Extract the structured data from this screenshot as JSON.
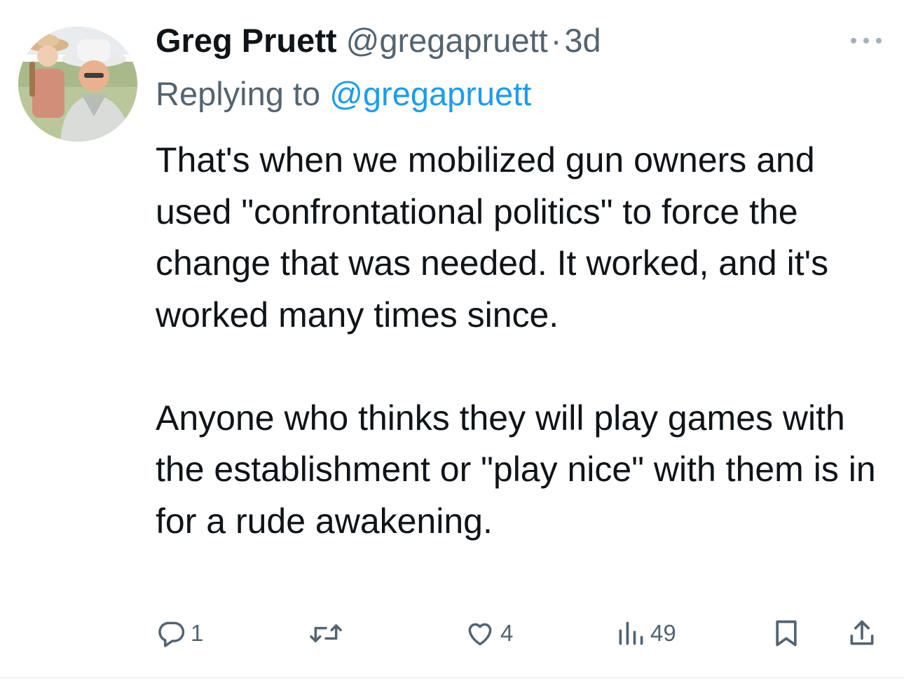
{
  "tweet": {
    "display_name": "Greg Pruett",
    "handle": "@gregapruett",
    "separator": "·",
    "time": "3d",
    "replying_prefix": "Replying to ",
    "replying_to": "@gregapruett",
    "paragraphs": [
      "That's when we mobilized gun owners and used \"confrontational politics\" to force the change that was needed. It worked, and it's worked many times since.",
      "Anyone who thinks they will play games with the establishment or \"play nice\" with them is in for a rude awakening."
    ]
  },
  "actions": {
    "replies": "1",
    "retweets": "",
    "likes": "4",
    "views": "49"
  },
  "icons": {
    "reply": "reply-icon",
    "retweet": "retweet-icon",
    "like": "heart-icon",
    "views": "views-icon",
    "bookmark": "bookmark-icon",
    "share": "share-icon",
    "more": "more-icon"
  },
  "colors": {
    "text": "#0f1419",
    "secondary": "#536471",
    "link": "#1d9bf0",
    "divider": "#e1e8ed"
  }
}
